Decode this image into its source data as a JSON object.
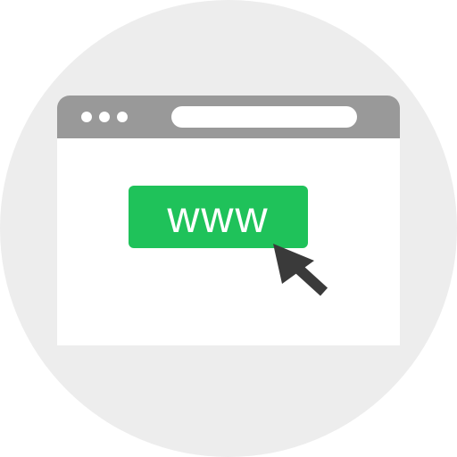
{
  "colors": {
    "background_circle": "#ededed",
    "window": "#ffffff",
    "title_bar": "#999999",
    "button": "#1fc25a",
    "button_text": "#ffffff",
    "cursor": "#3a3a3a"
  },
  "browser": {
    "controls": [
      "dot",
      "dot",
      "dot"
    ],
    "address_bar_text": ""
  },
  "button": {
    "label": "www"
  },
  "cursor": {
    "icon": "arrow-cursor-icon"
  }
}
